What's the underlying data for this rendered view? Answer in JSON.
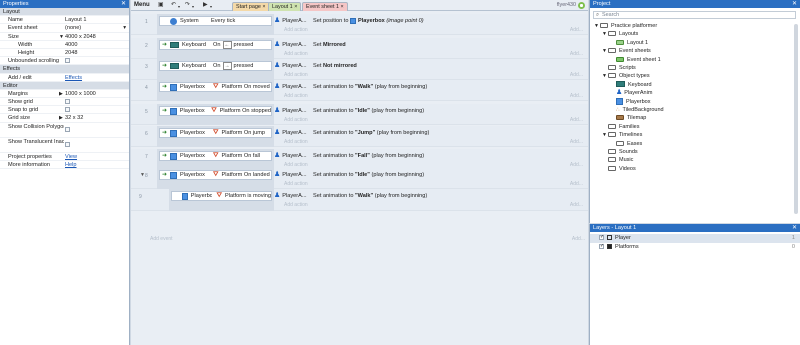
{
  "properties": {
    "title": "Properties",
    "rows": [
      {
        "type": "sec",
        "key": "Layout",
        "val": ""
      },
      {
        "type": "row",
        "key": "Name",
        "val": "Layout 1"
      },
      {
        "type": "row",
        "key": "Event sheet",
        "val": "(none)",
        "dropdown": true
      },
      {
        "type": "row",
        "key": "Size",
        "val": "4000 x 2048",
        "expand": "down"
      },
      {
        "type": "row",
        "key": "Width",
        "val": "4000",
        "indent": true
      },
      {
        "type": "row",
        "key": "Height",
        "val": "2048",
        "indent": true
      },
      {
        "type": "row",
        "key": "Unbounded scrolling",
        "val": "",
        "check": true
      },
      {
        "type": "sec",
        "key": "Effects",
        "val": ""
      },
      {
        "type": "row",
        "key": "Add / edit",
        "val": "Effects",
        "link": true
      },
      {
        "type": "sec",
        "key": "Editor",
        "val": ""
      },
      {
        "type": "row",
        "key": "Margins",
        "val": "1000 x 1000",
        "expand": "right"
      },
      {
        "type": "row",
        "key": "Show grid",
        "val": "",
        "check": true
      },
      {
        "type": "row",
        "key": "Snap to grid",
        "val": "",
        "check": true
      },
      {
        "type": "row",
        "key": "Grid size",
        "val": "32 x 32",
        "expand": "right"
      },
      {
        "type": "tall",
        "key": "Show Collision Polygons",
        "val": "",
        "check": true
      },
      {
        "type": "tall",
        "key": "Show Translucent Inactive Layers",
        "val": "",
        "check": true
      },
      {
        "type": "row",
        "key": "Project properties",
        "val": "View",
        "link": true
      },
      {
        "type": "row",
        "key": "More information",
        "val": "Help",
        "link": true
      }
    ]
  },
  "topbar": {
    "menu": "Menu",
    "tabs": [
      {
        "label": "Start page",
        "close": "×"
      },
      {
        "label": "Layout 1",
        "close": "×"
      },
      {
        "label": "Event sheet 1",
        "close": "×"
      }
    ],
    "username": "flyer430"
  },
  "events": [
    {
      "num": "1",
      "obj": "System",
      "icon": "gear",
      "cond": "Every tick",
      "actobj": "PlayerA...",
      "action": "Set position to",
      "actpost": "Playerbox",
      "actnote": "(image point 0)",
      "hasAct": true
    },
    {
      "num": "2",
      "obj": "Keyboard",
      "icon": "kbd",
      "cond": "On",
      "key": "←",
      "cond2": "pressed",
      "actobj": "PlayerA...",
      "action": "Set",
      "bold": "Mirrored",
      "hasAct": true,
      "trig": true
    },
    {
      "num": "3",
      "obj": "Keyboard",
      "icon": "kbd",
      "cond": "On",
      "key": "→",
      "cond2": "pressed",
      "actobj": "PlayerA...",
      "action": "Set",
      "bold": "Not mirrored",
      "hasAct": true,
      "trig": true
    },
    {
      "num": "4",
      "obj": "Playerbox",
      "icon": "box",
      "cond": "Platform On moved",
      "actobj": "PlayerA...",
      "action": "Set animation to",
      "bold": "\"Walk\"",
      "note": "(play from beginning)",
      "hasAct": true,
      "trig": true,
      "pf": true
    },
    {
      "num": "5",
      "obj": "Playerbox",
      "icon": "box",
      "cond": "Platform On stopped",
      "actobj": "PlayerA...",
      "action": "Set animation to",
      "bold": "\"Idle\"",
      "note": "(play from beginning)",
      "hasAct": true,
      "trig": true,
      "pf": true
    },
    {
      "num": "6",
      "obj": "Playerbox",
      "icon": "box",
      "cond": "Platform On jump",
      "actobj": "PlayerA...",
      "action": "Set animation to",
      "bold": "\"Jump\"",
      "note": "(play from beginning)",
      "hasAct": true,
      "trig": true,
      "pf": true
    },
    {
      "num": "7",
      "obj": "Playerbox",
      "icon": "box",
      "cond": "Platform On fall",
      "actobj": "PlayerA...",
      "action": "Set animation to",
      "bold": "\"Fall\"",
      "note": "(play from beginning)",
      "hasAct": true,
      "trig": true,
      "pf": true
    },
    {
      "num": "8",
      "obj": "Playerbox",
      "icon": "box",
      "cond": "Platform On landed",
      "actobj": "PlayerA...",
      "action": "Set animation to",
      "bold": "\"Idle\"",
      "note": "(play from beginning)",
      "hasAct": true,
      "trig": true,
      "pf": true,
      "expanded": true
    },
    {
      "num": "9",
      "obj": "Playerbox",
      "icon": "box",
      "cond": "Platform is moving",
      "actobj": "PlayerA...",
      "action": "Set animation to",
      "bold": "\"Walk\"",
      "note": "(play from beginning)",
      "hasAct": true,
      "pf": true,
      "sub": true
    }
  ],
  "sheet": {
    "add_action": "Add action",
    "add_event": "Add event",
    "add_sub": "Add..."
  },
  "project": {
    "title": "Project",
    "search": "Search",
    "tree": [
      {
        "label": "Practice platformer",
        "level": 0,
        "tri": "▼",
        "icon": "folder"
      },
      {
        "label": "Layouts",
        "level": 1,
        "tri": "▼",
        "icon": "folder"
      },
      {
        "label": "Layout 1",
        "level": 2,
        "icon": "layout"
      },
      {
        "label": "Event sheets",
        "level": 1,
        "tri": "▼",
        "icon": "folder"
      },
      {
        "label": "Event sheet 1",
        "level": 2,
        "icon": "sheet"
      },
      {
        "label": "Scripts",
        "level": 1,
        "icon": "folder"
      },
      {
        "label": "Object types",
        "level": 1,
        "tri": "▼",
        "icon": "folder"
      },
      {
        "label": "Keyboard",
        "level": 2,
        "icon": "kbd"
      },
      {
        "label": "PlayerAnim",
        "level": 2,
        "icon": "person"
      },
      {
        "label": "Playerbox",
        "level": 2,
        "icon": "box"
      },
      {
        "label": "TiledBackground",
        "level": 2,
        "icon": "tiled"
      },
      {
        "label": "Tilemap",
        "level": 2,
        "icon": "tilemap"
      },
      {
        "label": "Families",
        "level": 1,
        "icon": "folder"
      },
      {
        "label": "Timelines",
        "level": 1,
        "tri": "▼",
        "icon": "folder"
      },
      {
        "label": "Eases",
        "level": 2,
        "icon": "folder"
      },
      {
        "label": "Sounds",
        "level": 1,
        "icon": "folder"
      },
      {
        "label": "Music",
        "level": 1,
        "icon": "folder"
      },
      {
        "label": "Videos",
        "level": 1,
        "icon": "folder"
      }
    ]
  },
  "layers": {
    "title": "Layers - Layout 1",
    "rows": [
      {
        "name": "Player",
        "index": "1"
      },
      {
        "name": "Platforms",
        "index": "0"
      }
    ]
  }
}
